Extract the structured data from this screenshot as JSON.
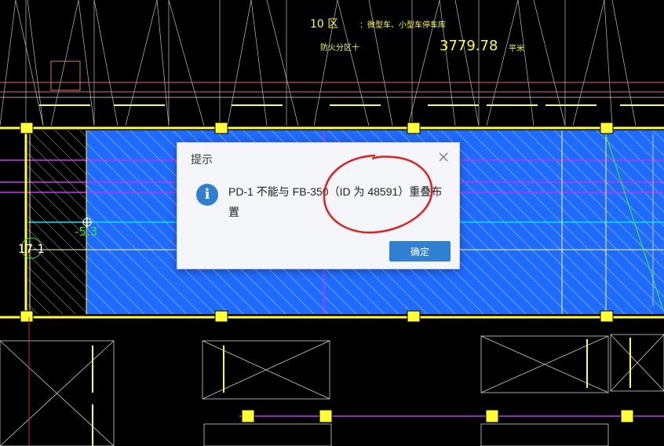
{
  "cad": {
    "zone_label": "10 区",
    "zone_desc": "：微型车、小型车停车库",
    "fire_label": "防火分区十",
    "area_value": "3779.78",
    "area_unit": "平米",
    "elevation_label": "-5.3",
    "axis_label": "17-1",
    "colors": {
      "background": "#000000",
      "slab": "#1e6bff",
      "beam": "#ffff33",
      "purple": "#cc33ff",
      "cyan": "#00e5ff",
      "green": "#2ee82e"
    }
  },
  "dialog": {
    "title": "提示",
    "icon": "info-icon",
    "message": "PD-1 不能与 FB-350（ID 为 48591）重叠布置",
    "ok_label": "确定"
  }
}
